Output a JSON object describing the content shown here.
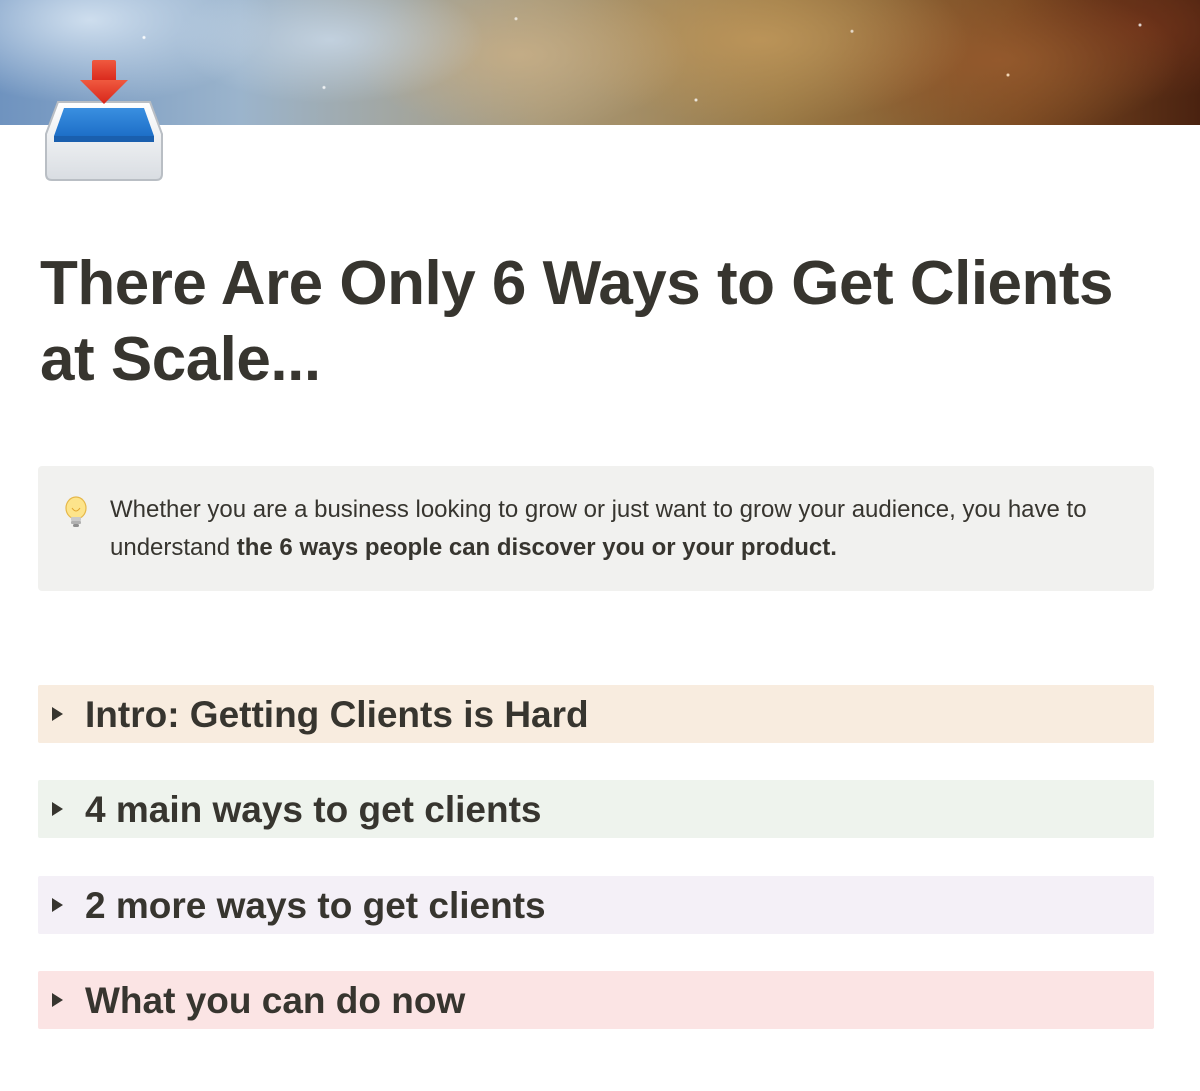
{
  "cover": {
    "icon": "nebula-cover-image"
  },
  "page_icon": "inbox-tray-icon",
  "title": "There Are Only 6 Ways to Get Clients at Scale...",
  "callout": {
    "icon": "lightbulb-icon",
    "text_before": "Whether you are a business looking to grow or just want to grow your audience, you have to understand ",
    "text_bold": "the 6 ways people can discover you or your product."
  },
  "toggles": [
    {
      "label": "Intro: Getting Clients is Hard",
      "color": "#f8ecdf"
    },
    {
      "label": "4 main ways to get clients",
      "color": "#eef3ed"
    },
    {
      "label": "2 more ways to get clients",
      "color": "#f4f0f7"
    },
    {
      "label": "What you can do now",
      "color": "#fbe4e4"
    }
  ]
}
